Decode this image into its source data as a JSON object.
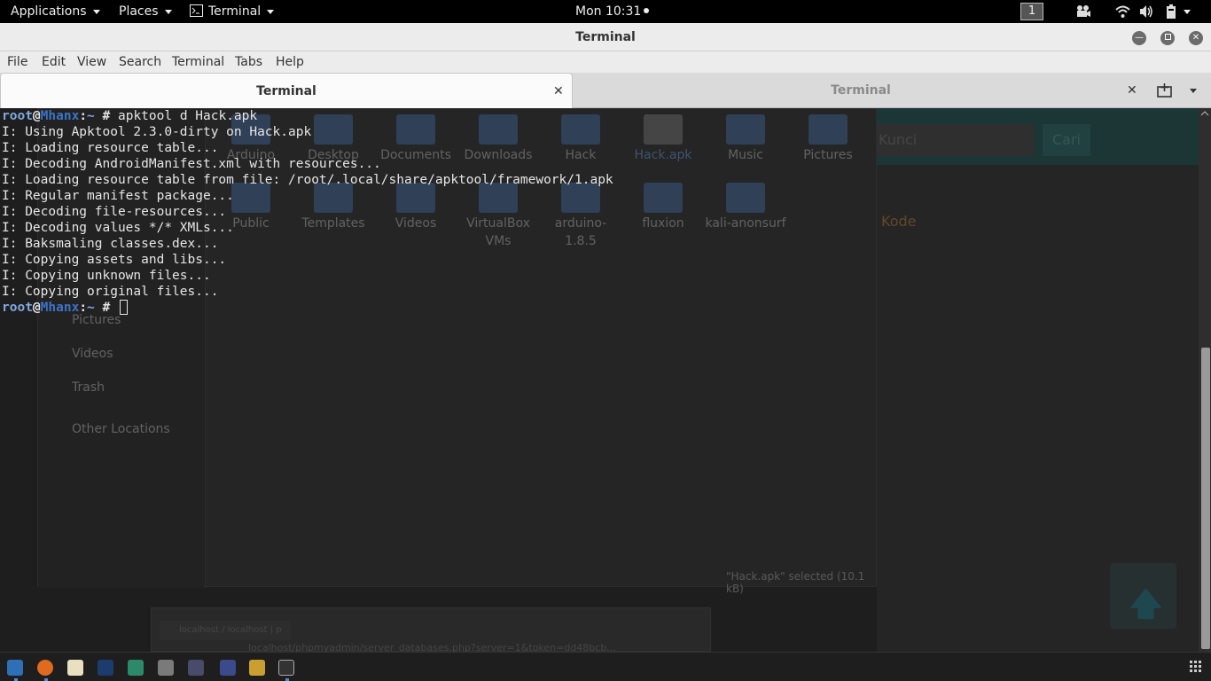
{
  "topbar": {
    "applications": "Applications",
    "places": "Places",
    "app_menu": "Terminal",
    "clock": "Mon 10:31",
    "workspace": "1"
  },
  "window": {
    "title": "Terminal",
    "menu": [
      "File",
      "Edit",
      "View",
      "Search",
      "Terminal",
      "Tabs",
      "Help"
    ],
    "tabs": [
      {
        "label": "Terminal",
        "active": true
      },
      {
        "label": "Terminal",
        "active": false
      }
    ]
  },
  "terminal": {
    "prompt": {
      "user": "root",
      "host": "Mhanx",
      "path": "~",
      "symbol": "#"
    },
    "command": "apktool d Hack.apk",
    "output": [
      "I: Using Apktool 2.3.0-dirty on Hack.apk",
      "I: Loading resource table...",
      "I: Decoding AndroidManifest.xml with resources...",
      "I: Loading resource table from file: /root/.local/share/apktool/framework/1.apk",
      "I: Regular manifest package...",
      "I: Decoding file-resources...",
      "I: Decoding values */* XMLs...",
      "I: Baksmaling classes.dex...",
      "I: Copying assets and libs...",
      "I: Copying unknown files...",
      "I: Copying original files..."
    ]
  },
  "background": {
    "file_manager": {
      "row1": [
        "Arduino",
        "Desktop",
        "Documents",
        "Downloads",
        "Hack",
        "Hack.apk",
        "Music",
        "Pictures"
      ],
      "row2": [
        "Public",
        "Templates",
        "Videos",
        "VirtualBox VMs",
        "arduino-1.8.5",
        "fluxion",
        "kali-anonsurf"
      ],
      "sidebar": [
        "Pictures",
        "Videos",
        "Trash",
        "Other Locations"
      ],
      "status": "\"Hack.apk\" selected  (10.1 kB)"
    },
    "web": {
      "input_placeholder": "Kunci",
      "button": "Cari",
      "kode_label": "Kode"
    },
    "browser": {
      "tab": "localhost / localhost | p",
      "url": "localhost/phpmyadmin/server_databases.php?server=1&token=dd48bcb..."
    }
  },
  "taskbar": {
    "apps": [
      "files-icon",
      "firefox-icon",
      "text-editor-icon",
      "metasploit-icon",
      "armitage-icon",
      "burp-icon",
      "maltego-icon",
      "settings-icon",
      "kali-icon",
      "terminal-icon"
    ]
  },
  "colors": {
    "terminal_bg": "#1e1e1e",
    "prompt_user": "#7fa8e0",
    "prompt_host": "#3c73c8"
  }
}
